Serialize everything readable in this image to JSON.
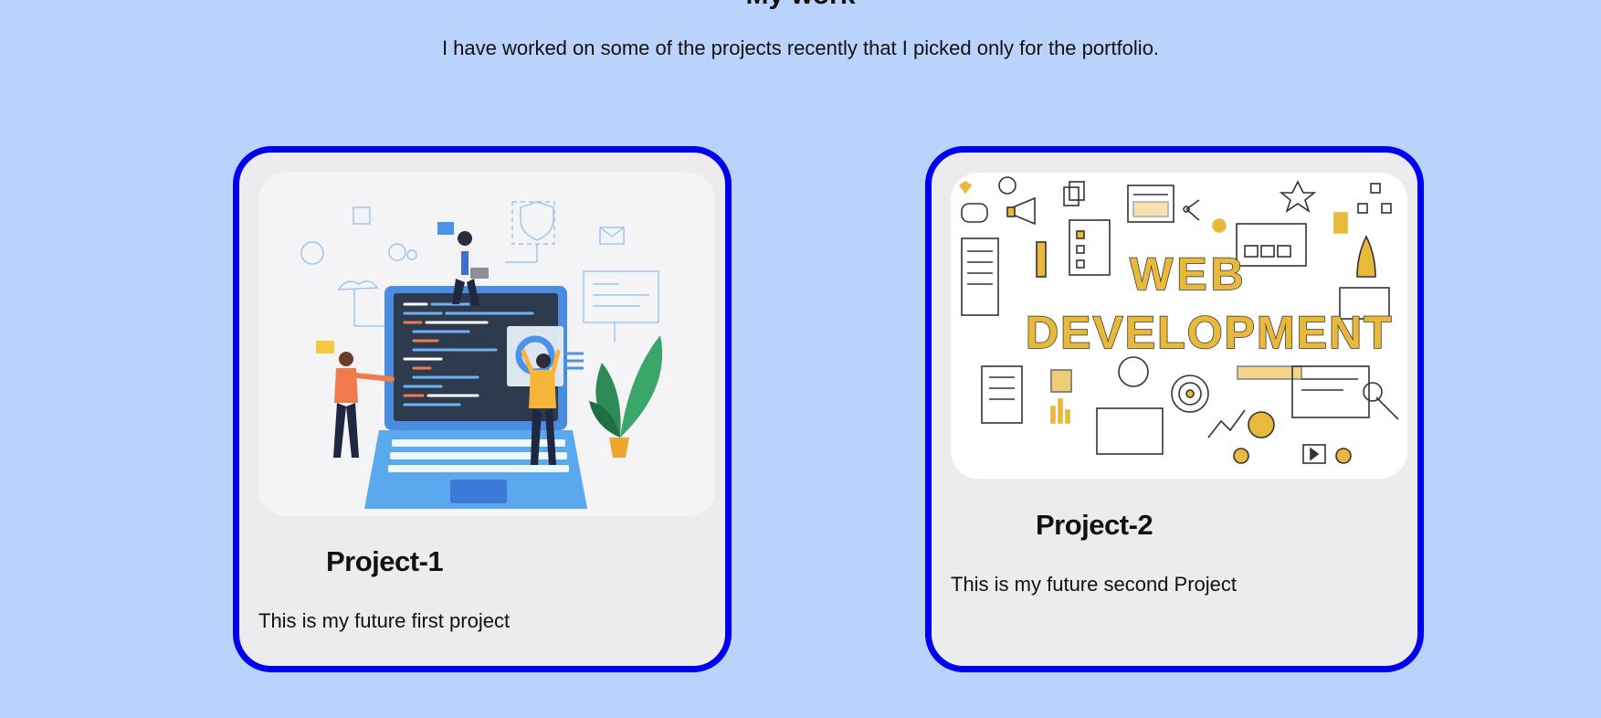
{
  "section": {
    "title": "My work",
    "subtitle": "I have worked on some of the projects recently that I picked only for the portfolio."
  },
  "projects": [
    {
      "title": "Project-1",
      "description": "This is my future first project",
      "image": "laptop-coding-team-illustration"
    },
    {
      "title": "Project-2",
      "description": "This is my future second Project",
      "image": "web-development-doodle-illustration",
      "image_text": [
        "WEB",
        "DEVELOPMENT"
      ]
    }
  ],
  "colors": {
    "page_background": "#bad3fc",
    "card_border": "#0000ee",
    "card_background": "#ecebee",
    "doodle_accent": "#e8b93a"
  }
}
